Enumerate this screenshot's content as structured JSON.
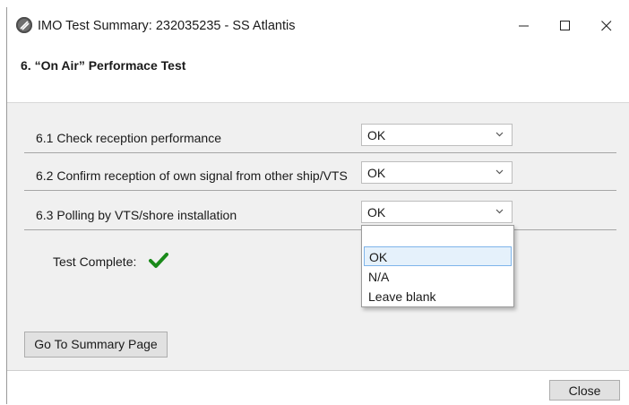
{
  "window": {
    "title": "IMO Test Summary: 232035235 - SS Atlantis",
    "icon": "app-logo-icon",
    "controls": [
      "minimize-icon",
      "maximize-icon",
      "close-icon"
    ]
  },
  "section": {
    "title": "6. “On Air” Performace Test"
  },
  "rows": [
    {
      "label": "6.1 Check reception performance",
      "value": "OK"
    },
    {
      "label": "6.2 Confirm reception of own signal from other ship/VTS",
      "value": "OK"
    },
    {
      "label": "6.3 Polling by VTS/shore installation",
      "value": "OK"
    }
  ],
  "dropdown": {
    "options": [
      "",
      "OK",
      "N/A",
      "Leave blank"
    ],
    "selected": "OK"
  },
  "status": {
    "label": "Test Complete:",
    "icon": "checkmark-icon",
    "color": "#1a8a1a"
  },
  "buttons": {
    "summary": "Go To Summary Page",
    "close": "Close"
  }
}
